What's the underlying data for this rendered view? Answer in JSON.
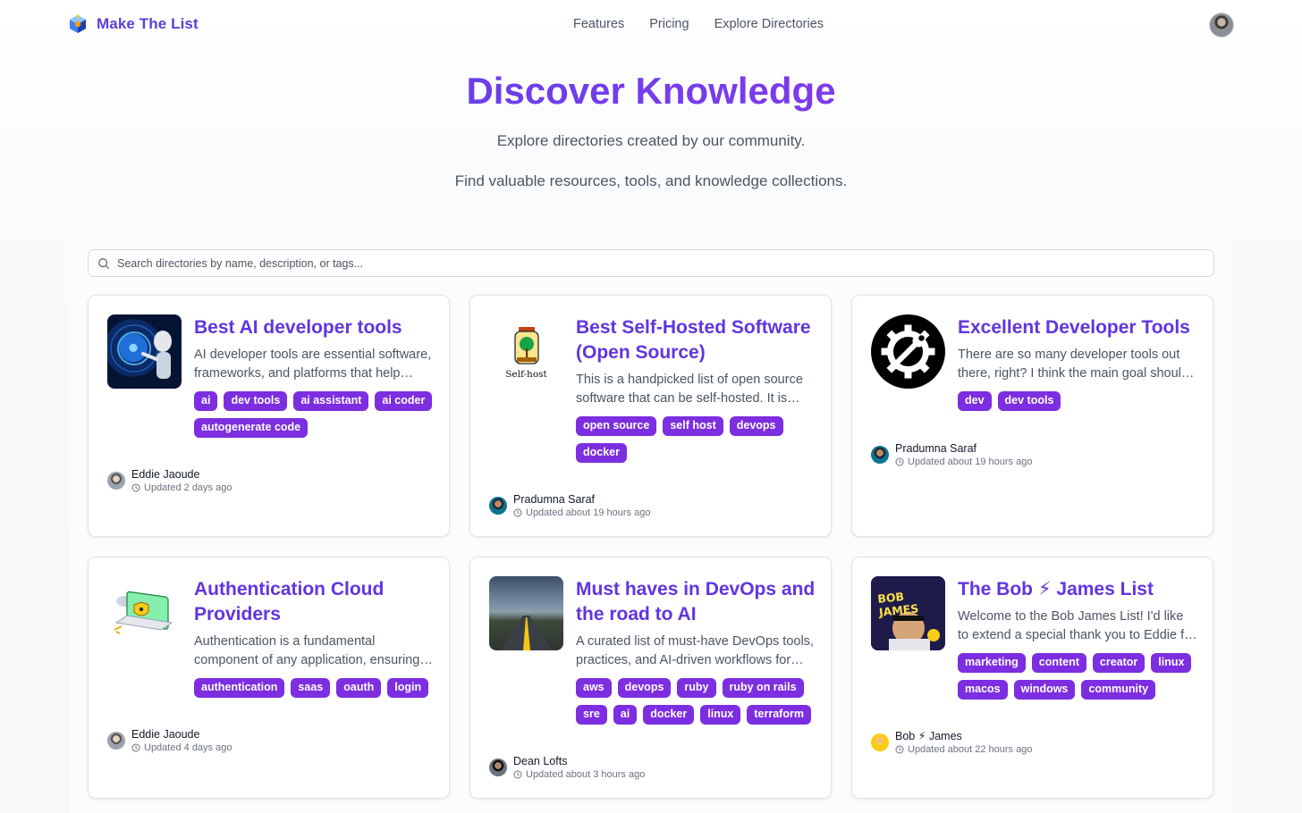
{
  "brand": {
    "name": "Make The List"
  },
  "nav": {
    "links": [
      "Features",
      "Pricing",
      "Explore Directories"
    ]
  },
  "hero": {
    "title": "Discover Knowledge",
    "subtitle1": "Explore directories created by our community.",
    "subtitle2": "Find valuable resources, tools, and knowledge collections."
  },
  "search": {
    "placeholder": "Search directories by name, description, or tags..."
  },
  "cards": [
    {
      "title": "Best AI developer tools",
      "description": "AI developer tools are essential software, frameworks, and platforms that help developers build AI apps",
      "tags": [
        "ai",
        "dev tools",
        "ai assistant",
        "ai coder",
        "autogenerate code"
      ],
      "author": "Eddie Jaoude",
      "updated": "Updated 2 days ago"
    },
    {
      "title": "Best Self-Hosted Software (Open Source)",
      "thumb_caption": "Self-host",
      "description": "This is a handpicked list of open source software that can be self-hosted. It is curated for homelab users",
      "tags": [
        "open source",
        "self host",
        "devops",
        "docker"
      ],
      "author": "Pradumna Saraf",
      "updated": "Updated about 19 hours ago"
    },
    {
      "title": "Excellent Developer Tools",
      "description": "There are so many developer tools out there, right? I think the main goal should be productivity",
      "tags": [
        "dev",
        "dev tools"
      ],
      "author": "Pradumna Saraf",
      "updated": "Updated about 19 hours ago"
    },
    {
      "title": "Authentication Cloud Providers",
      "description": "Authentication is a fundamental component of any application, ensuring secure access for users",
      "tags": [
        "authentication",
        "saas",
        "oauth",
        "login"
      ],
      "author": "Eddie Jaoude",
      "updated": "Updated 4 days ago"
    },
    {
      "title": "Must haves in DevOps and the road to AI",
      "description": "A curated list of must-have DevOps tools, practices, and AI-driven workflows for modern teams",
      "tags": [
        "aws",
        "devops",
        "ruby",
        "ruby on rails",
        "sre",
        "ai",
        "docker",
        "linux",
        "terraform"
      ],
      "author": "Dean Lofts",
      "updated": "Updated about 3 hours ago"
    },
    {
      "title": "The Bob ⚡ James List",
      "thumb_caption": "BOB JAMES",
      "description": "Welcome to the Bob James List! I'd like to extend a special thank you to Eddie for everything",
      "tags": [
        "marketing",
        "content",
        "creator",
        "linux",
        "macos",
        "windows",
        "community"
      ],
      "author": "Bob ⚡ James",
      "updated": "Updated about 22 hours ago"
    }
  ],
  "colors": {
    "accent": "#6135e0",
    "tag": "#7c2ee0",
    "title_gradient_start": "#4f46e5",
    "title_gradient_end": "#8b3fe6"
  }
}
